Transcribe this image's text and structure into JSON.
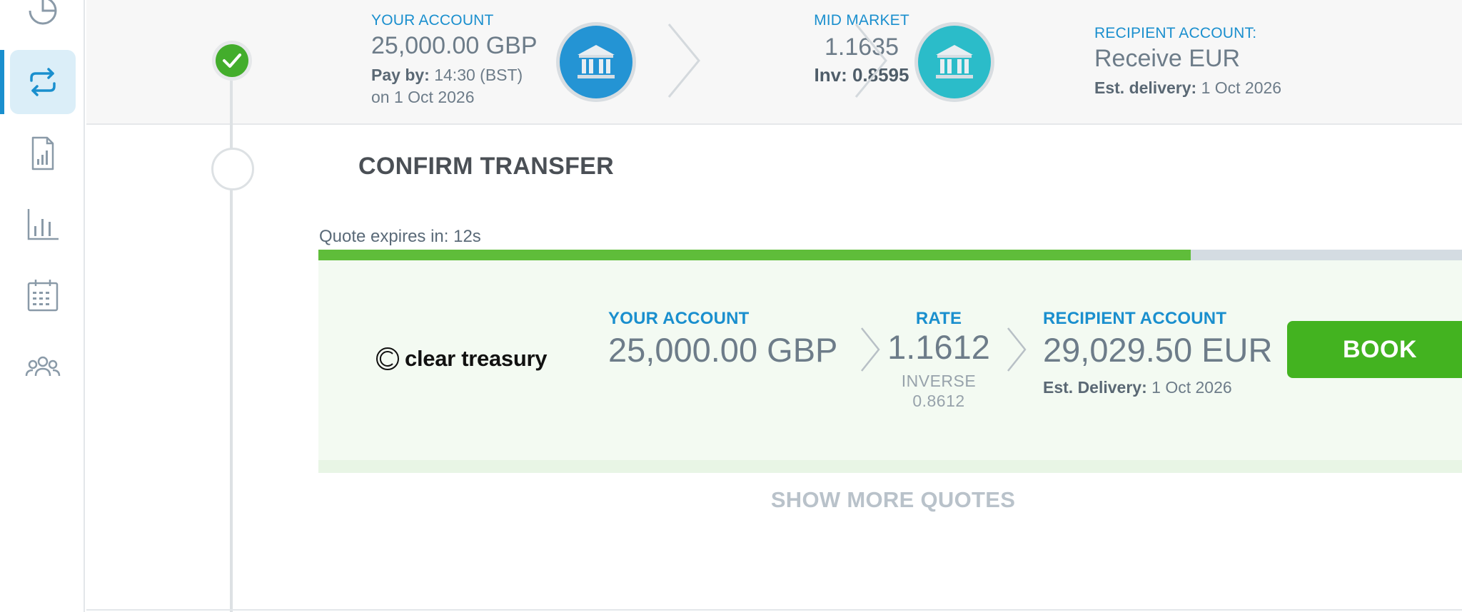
{
  "colors": {
    "accent": "#1a8fce",
    "success": "#43ad2c",
    "book_button": "#43b320",
    "progress_fill": "#5fbd3a",
    "progress_track": "#d4dce2",
    "bank_icon_blue": "#2494d4",
    "bank_icon_teal": "#2bbcc9"
  },
  "sidebar": {
    "items": [
      {
        "icon": "pie-chart-icon",
        "active": false
      },
      {
        "icon": "transfer-icon",
        "active": true
      },
      {
        "icon": "report-icon",
        "active": false
      },
      {
        "icon": "bar-chart-icon",
        "active": false
      },
      {
        "icon": "calendar-icon",
        "active": false
      },
      {
        "icon": "users-icon",
        "active": false
      }
    ]
  },
  "summary": {
    "your_account_label": "YOUR ACCOUNT",
    "your_account_amount": "25,000.00 GBP",
    "pay_by_label": "Pay by:",
    "pay_by_time": "14:30 (BST)",
    "pay_by_date": "on 1 Oct 2026",
    "mid_market_label": "MID MARKET",
    "mid_market_rate": "1.1635",
    "inverse_text": "Inv: 0.8595",
    "recipient_label": "RECIPIENT ACCOUNT:",
    "recipient_value": "Receive EUR",
    "est_delivery_label": "Est. delivery:",
    "est_delivery_date": "1 Oct 2026"
  },
  "confirm": {
    "title": "CONFIRM TRANSFER",
    "expires_text": "Quote expires in: 12s",
    "progress_fraction": 0.72
  },
  "quote": {
    "provider_name": "clear treasury",
    "your_account_label": "YOUR ACCOUNT",
    "your_account_amount": "25,000.00 GBP",
    "rate_label": "RATE",
    "rate_value": "1.1612",
    "inverse_label": "INVERSE",
    "inverse_value": "0.8612",
    "recipient_label": "RECIPIENT ACCOUNT",
    "recipient_amount": "29,029.50 EUR",
    "est_delivery_label": "Est. Delivery:",
    "est_delivery_date": "1 Oct 2026",
    "book_label": "BOOK"
  },
  "show_more_label": "SHOW MORE QUOTES"
}
